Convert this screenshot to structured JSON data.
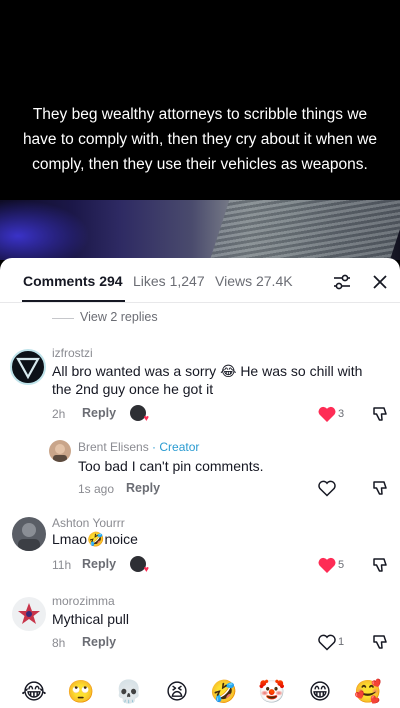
{
  "caption": "They beg wealthy attorneys to scribble things we have to comply with, then they cry about it when we comply, then they use their vehicles as weapons.",
  "tabs": {
    "comments_label": "Comments 294",
    "likes_label": "Likes 1,247",
    "views_label": "Views 27.4K"
  },
  "view_replies": "View 2 replies",
  "comments": [
    {
      "username": "izfrostzi",
      "text": "All bro wanted was a sorry 😂 He was so chill with the 2nd guy once he got it",
      "time": "2h",
      "reply_label": "Reply",
      "likes": "3",
      "liked": true
    },
    {
      "username": "Brent Elisens",
      "badge": " · Creator",
      "text": "Too bad I can't pin comments.",
      "time": "1s ago",
      "reply_label": "Reply",
      "likes": "",
      "liked": false
    },
    {
      "username": "Ashton Yourrr",
      "text": "Lmao🤣noice",
      "time": "11h",
      "reply_label": "Reply",
      "likes": "5",
      "liked": true
    },
    {
      "username": "morozimma",
      "text": "Mythical pull",
      "time": "8h",
      "reply_label": "Reply",
      "likes": "1",
      "liked": false
    }
  ],
  "emojis": [
    "😂",
    "🙄",
    "💀",
    "😫",
    "🤣",
    "🤡",
    "😁",
    "🥰"
  ],
  "colors": {
    "like_red": "#fe2c55",
    "creator_blue": "#2a9bd1"
  }
}
